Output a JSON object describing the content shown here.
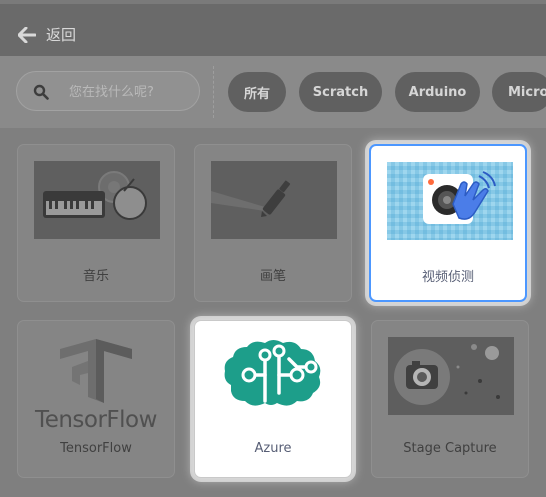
{
  "header": {
    "back_label": "返回"
  },
  "search": {
    "placeholder": "您在找什么呢?"
  },
  "tags": [
    {
      "label": "所有"
    },
    {
      "label": "Scratch"
    },
    {
      "label": "Arduino"
    },
    {
      "label": "Micro"
    }
  ],
  "extensions": [
    {
      "name": "音乐",
      "state": "dimmed"
    },
    {
      "name": "画笔",
      "state": "dimmed"
    },
    {
      "name": "视频侦测",
      "state": "selected"
    },
    {
      "name": "TensorFlow",
      "logo_text": "TensorFlow",
      "state": "dimmed"
    },
    {
      "name": "Azure",
      "state": "highlighted"
    },
    {
      "name": "Stage Capture",
      "state": "dimmed"
    }
  ],
  "colors": {
    "accent": "#4c97ff",
    "azure_teal": "#1d9e8a"
  },
  "icons": [
    "back-arrow-icon",
    "search-icon",
    "music-keyboard-drum-icon",
    "pen-icon",
    "video-hand-icon",
    "tensorflow-logo-icon",
    "azure-brain-circuit-icon",
    "camera-icon"
  ]
}
